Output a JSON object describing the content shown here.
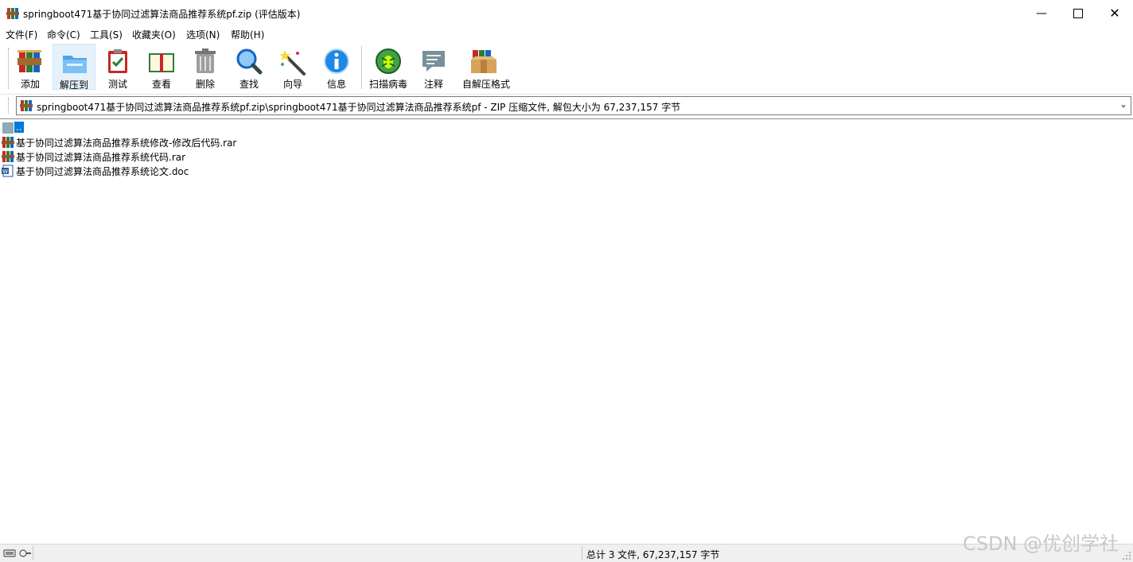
{
  "window": {
    "title": "springboot471基于协同过滤算法商品推荐系统pf.zip (评估版本)",
    "minimize_icon": "minimize-icon",
    "maximize_icon": "maximize-icon",
    "close_icon": "close-icon"
  },
  "menu": {
    "items": [
      {
        "label": "文件(F)"
      },
      {
        "label": "命令(C)"
      },
      {
        "label": "工具(S)"
      },
      {
        "label": "收藏夹(O)"
      },
      {
        "label": "选项(N)"
      },
      {
        "label": "帮助(H)"
      }
    ]
  },
  "toolbar": {
    "buttons": [
      {
        "label": "添加",
        "icon": "add-archive-icon"
      },
      {
        "label": "解压到",
        "icon": "extract-folder-icon"
      },
      {
        "label": "测试",
        "icon": "test-clipboard-icon"
      },
      {
        "label": "查看",
        "icon": "view-book-icon"
      },
      {
        "label": "删除",
        "icon": "trash-icon"
      },
      {
        "label": "查找",
        "icon": "magnifier-icon"
      },
      {
        "label": "向导",
        "icon": "wizard-wand-icon"
      },
      {
        "label": "信息",
        "icon": "info-icon"
      },
      {
        "label": "扫描病毒",
        "icon": "virus-scan-icon"
      },
      {
        "label": "注释",
        "icon": "comment-icon"
      },
      {
        "label": "自解压格式",
        "icon": "sfx-box-icon"
      }
    ]
  },
  "address": {
    "path": "springboot471基于协同过滤算法商品推荐系统pf.zip\\springboot471基于协同过滤算法商品推荐系统pf - ZIP 压缩文件, 解包大小为 67,237,157 字节"
  },
  "files": {
    "updir": "..",
    "items": [
      {
        "name": "基于协同过滤算法商品推荐系统修改-修改后代码.rar",
        "icon": "rar-archive-icon"
      },
      {
        "name": "基于协同过滤算法商品推荐系统代码.rar",
        "icon": "rar-archive-icon"
      },
      {
        "name": "基于协同过滤算法商品推荐系统论文.doc",
        "icon": "word-document-icon"
      }
    ]
  },
  "status": {
    "summary": "总计 3 文件, 67,237,157 字节"
  },
  "watermark": "CSDN @优创学社",
  "colors": {
    "selection": "#0078d7",
    "status_bg": "#f0f0f0",
    "active_tool_bg": "#e5f1fb"
  }
}
